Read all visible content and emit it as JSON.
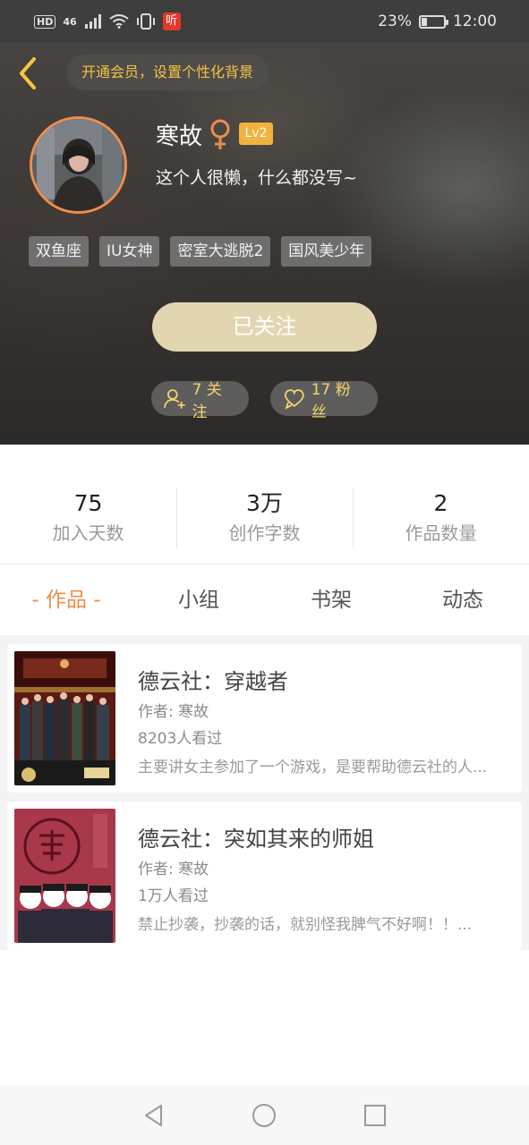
{
  "status_bar": {
    "hd": "HD",
    "network": "46",
    "listen_badge": "听",
    "battery": "23%",
    "time": "12:00"
  },
  "header": {
    "vip_prompt": "开通会员，设置个性化背景"
  },
  "profile": {
    "username": "寒故",
    "gender": "female",
    "level": "Lv2",
    "bio": "这个人很懒，什么都没写~",
    "tags": [
      "双鱼座",
      "IU女神",
      "密室大逃脱2",
      "国风美少年"
    ],
    "follow_button": "已关注",
    "follows": "7 关注",
    "fans": "17 粉丝"
  },
  "stats": [
    {
      "value": "75",
      "label": "加入天数"
    },
    {
      "value": "3万",
      "label": "创作字数"
    },
    {
      "value": "2",
      "label": "作品数量"
    }
  ],
  "tabs": [
    {
      "label": "- 作品 -",
      "active": true
    },
    {
      "label": "小组",
      "active": false
    },
    {
      "label": "书架",
      "active": false
    },
    {
      "label": "动态",
      "active": false
    }
  ],
  "works": [
    {
      "title": "德云社：穿越者",
      "author": "作者: 寒故",
      "views": "8203人看过",
      "desc": "主要讲女主参加了一个游戏，是要帮助德云社的人..."
    },
    {
      "title": "德云社：突如其来的师姐",
      "author": "作者: 寒故",
      "views": "1万人看过",
      "desc": "禁止抄袭，抄袭的话，就别怪我脾气不好啊！！..."
    }
  ],
  "colors": {
    "accent": "#ef8c4b",
    "vip_text": "#f5c343",
    "level_badge": "#f1b33d",
    "follow_button": "#e2d5b1",
    "stat_pill_text": "#f4d46b"
  }
}
